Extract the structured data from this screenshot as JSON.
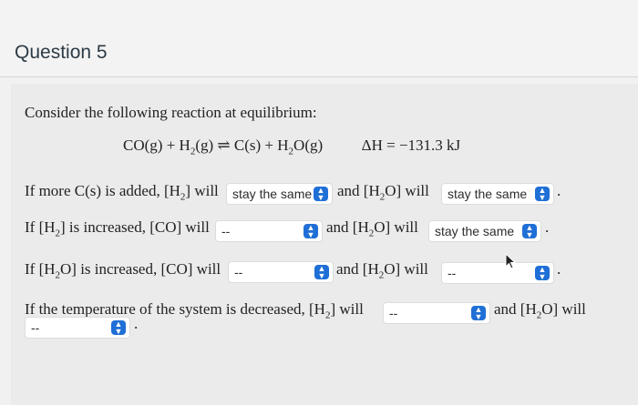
{
  "question": {
    "title": "Question 5"
  },
  "prompt": "Consider the following reaction at equilibrium:",
  "equation": {
    "left": "CO(g) + H",
    "left_sub": "2",
    "left_end": "(g)",
    "arrow": "⇌",
    "right": "C(s) + H",
    "right_sub": "2",
    "right_end": "O(g)",
    "dh": "ΔH = −131.3 kJ"
  },
  "rows": [
    {
      "text_a": "If more C(s) is added, [H",
      "sub_a": "2",
      "text_b": "] will",
      "select1": "stay the same",
      "mid": "and [H",
      "sub_m": "2",
      "mid_end": "O] will",
      "select2": "stay the same"
    },
    {
      "text_a": "If [H",
      "sub_a": "2",
      "text_b": "] is increased, [CO] will",
      "select1": "--",
      "mid": "and [H",
      "sub_m": "2",
      "mid_end": "O] will",
      "select2": "stay the same"
    },
    {
      "text_a": "If [H",
      "sub_a": "2",
      "text_b": "O] is increased, [CO] will",
      "select1": "--",
      "mid": "and [H",
      "sub_m": "2",
      "mid_end": "O] will",
      "select2": "--"
    },
    {
      "text_a": "If the temperature of the system is decreased, [H",
      "sub_a": "2",
      "text_b": "] will",
      "select1": "--",
      "mid": "and [H",
      "sub_m": "2",
      "mid_end": "O] will",
      "select2": "--"
    }
  ],
  "icons": {
    "select_arrow": "chevron-up-down-icon",
    "cursor": "mouse-pointer-icon"
  },
  "colors": {
    "accent": "#1f6fd6"
  }
}
